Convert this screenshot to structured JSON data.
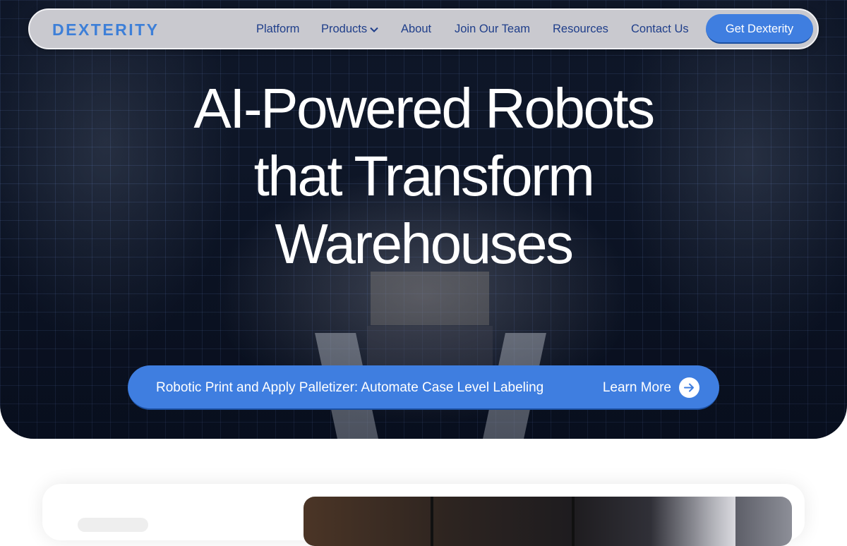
{
  "brand": {
    "logo_text": "DEXTERITY",
    "accent_color": "#3f7ee0",
    "nav_text_color": "#1f3e8a"
  },
  "nav": {
    "items": [
      {
        "label": "Platform"
      },
      {
        "label": "Products",
        "icon": "chevron-down-icon"
      },
      {
        "label": "About"
      },
      {
        "label": "Join Our Team"
      },
      {
        "label": "Resources"
      },
      {
        "label": "Contact Us"
      }
    ],
    "cta_label": "Get Dexterity"
  },
  "hero": {
    "headline_lines": [
      "AI-Powered Robots",
      "that Transform",
      "Warehouses"
    ],
    "background": "dark warehouse robot image with blue grid overlay"
  },
  "announcement": {
    "text": "Robotic Print and Apply Palletizer: Automate Case Level Labeling",
    "link_label": "Learn More",
    "icon": "arrow-right-circle-icon"
  }
}
